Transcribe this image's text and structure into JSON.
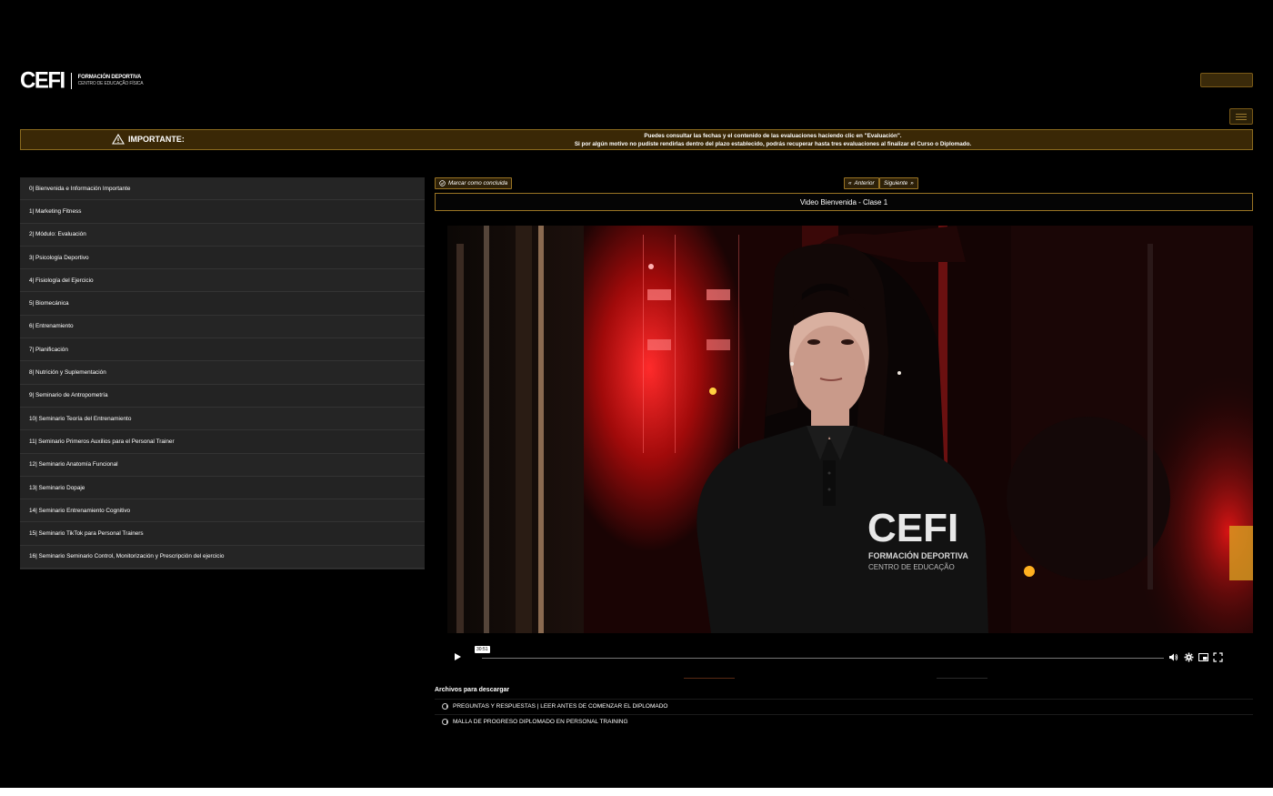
{
  "header": {
    "logo_mark": "CEFI",
    "logo_line1": "FORMACIÓN DEPORTIVA",
    "logo_line2": "CENTRO DE EDUCAÇÃO FÍSICA"
  },
  "notice": {
    "label": "IMPORTANTE:",
    "line1": "Puedes consultar las fechas y el contenido de las evaluaciones haciendo clic en \"Evaluación\".",
    "line2": "Si por algún motivo no pudiste rendirlas dentro del plazo establecido, podrás recuperar hasta tres evaluaciones al finalizar el Curso o Diplomado."
  },
  "sidebar": {
    "items": [
      "0| Bienvenida e Información Importante",
      "1| Marketing Fitness",
      "2| Módulo: Evaluación",
      "3| Psicología Deportivo",
      "4| Fisiología del Ejercicio",
      "5| Biomecánica",
      "6| Entrenamiento",
      "7| Planificación",
      "8| Nutrición y Suplementación",
      "9| Seminario de Antropometría",
      "10| Seminario Teoría del Entrenamiento",
      "11| Seminario Primeros Auxilios para el Personal Trainer",
      "12| Seminario Anatomía Funcional",
      "13| Seminario Dopaje",
      "14| Seminario Entrenamiento Cognitivo",
      "15| Seminario TikTok para Personal Trainers",
      "16| Seminario Seminario Control, Monitorización y Prescripción del ejercicio"
    ]
  },
  "lesson": {
    "mark_done": "Marcar como concluida",
    "prev": "Anterior",
    "next": "Siguiente",
    "title": "Video Bienvenida - Clase 1",
    "shirt_brand": "CEFI",
    "shirt_line1": "FORMACIÓN DEPORTIVA",
    "shirt_line2": "CENTRO DE EDUCAÇÃO"
  },
  "player": {
    "time": "30:51",
    "progress": 0
  },
  "files": {
    "title": "Archivos para descargar",
    "items": [
      "PREGUNTAS Y RESPUESTAS | LEER ANTES DE COMENZAR EL DIPLOMADO",
      "MALLA DE PROGRESO DIPLOMADO EN PERSONAL TRAINING"
    ]
  },
  "colors": {
    "accent": "#9a7424",
    "notice_bg": "#3a2806",
    "sidebar_bg": "#252525"
  }
}
